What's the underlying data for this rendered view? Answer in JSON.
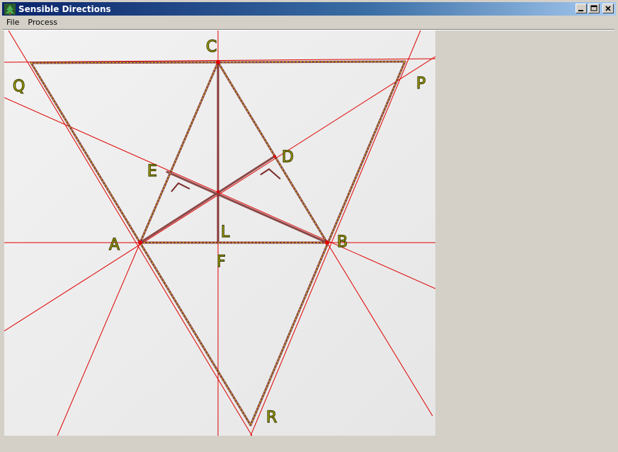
{
  "window": {
    "title": "Sensible Directions",
    "icon": "tree-app-icon",
    "controls": [
      "minimize-icon",
      "maximize-icon",
      "close-icon"
    ]
  },
  "menu": {
    "items": [
      {
        "label": "File"
      },
      {
        "label": "Process"
      }
    ]
  },
  "canvas": {
    "labels": {
      "A": "A",
      "B": "B",
      "C": "C",
      "D": "D",
      "E": "E",
      "F": "F",
      "L": "L",
      "P": "P",
      "Q": "Q",
      "R": "R"
    },
    "colors": {
      "background": "#eeeeee",
      "red_line": "#e00000",
      "stroke": "#7a2a2a",
      "highlight": "#f0f000"
    }
  }
}
